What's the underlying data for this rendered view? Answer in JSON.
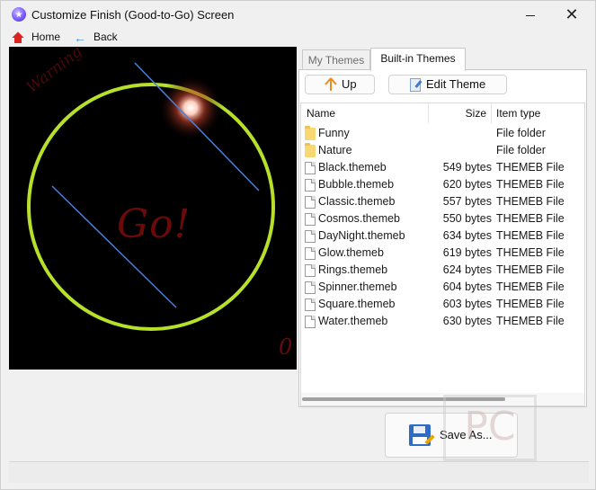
{
  "window": {
    "title": "Customize Finish (Good-to-Go) Screen",
    "minimize_symbol": "",
    "close_symbol": "✕"
  },
  "nav": {
    "home_label": "Home",
    "back_label": "Back"
  },
  "preview": {
    "main_text": "Go!",
    "arc_text": "Warning",
    "corner_text": "0",
    "ring_color": "#b7e02a"
  },
  "tabs": [
    {
      "label": "My Themes",
      "active": false
    },
    {
      "label": "Built-in Themes",
      "active": true
    }
  ],
  "toolbar": {
    "up_label": "Up",
    "edit_label": "Edit Theme"
  },
  "filelist": {
    "columns": {
      "name": "Name",
      "size": "Size",
      "type": "Item type"
    },
    "rows": [
      {
        "name": "Funny",
        "size": "",
        "type": "File folder",
        "icon": "folder-icon"
      },
      {
        "name": "Nature",
        "size": "",
        "type": "File folder",
        "icon": "folder-icon"
      },
      {
        "name": "Black.themeb",
        "size": "549 bytes",
        "type": "THEMEB File",
        "icon": "file-icon"
      },
      {
        "name": "Bubble.themeb",
        "size": "620 bytes",
        "type": "THEMEB File",
        "icon": "file-icon"
      },
      {
        "name": "Classic.themeb",
        "size": "557 bytes",
        "type": "THEMEB File",
        "icon": "file-icon"
      },
      {
        "name": "Cosmos.themeb",
        "size": "550 bytes",
        "type": "THEMEB File",
        "icon": "file-icon"
      },
      {
        "name": "DayNight.themeb",
        "size": "634 bytes",
        "type": "THEMEB File",
        "icon": "file-icon"
      },
      {
        "name": "Glow.themeb",
        "size": "619 bytes",
        "type": "THEMEB File",
        "icon": "file-icon"
      },
      {
        "name": "Rings.themeb",
        "size": "624 bytes",
        "type": "THEMEB File",
        "icon": "file-icon"
      },
      {
        "name": "Spinner.themeb",
        "size": "604 bytes",
        "type": "THEMEB File",
        "icon": "file-icon"
      },
      {
        "name": "Square.themeb",
        "size": "603 bytes",
        "type": "THEMEB File",
        "icon": "file-icon"
      },
      {
        "name": "Water.themeb",
        "size": "630 bytes",
        "type": "THEMEB File",
        "icon": "file-icon"
      }
    ]
  },
  "save": {
    "label": "Save As..."
  },
  "watermark": {
    "text": "PC"
  }
}
